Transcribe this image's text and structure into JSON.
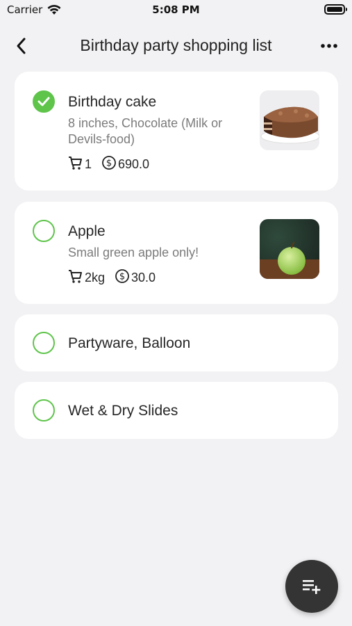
{
  "status_bar": {
    "carrier": "Carrier",
    "time": "5:08 PM"
  },
  "header": {
    "title": "Birthday party shopping list",
    "back_icon": "chevron-left-icon",
    "more_icon": "more-horizontal-icon"
  },
  "colors": {
    "accent": "#5ec44a",
    "background": "#f2f2f4",
    "card": "#ffffff",
    "fab": "#343434"
  },
  "items": [
    {
      "title": "Birthday cake",
      "description": "8 inches, Chocolate (Milk or Devils-food)",
      "quantity": "1",
      "price": "690.0",
      "checked": true,
      "image": "chocolate-cake-image"
    },
    {
      "title": "Apple",
      "description": "Small green apple only!",
      "quantity": "2kg",
      "price": "30.0",
      "checked": false,
      "image": "green-apple-image"
    },
    {
      "title": "Partyware, Balloon",
      "checked": false
    },
    {
      "title": "Wet & Dry Slides",
      "checked": false
    }
  ],
  "fab": {
    "icon": "playlist-add-icon"
  }
}
